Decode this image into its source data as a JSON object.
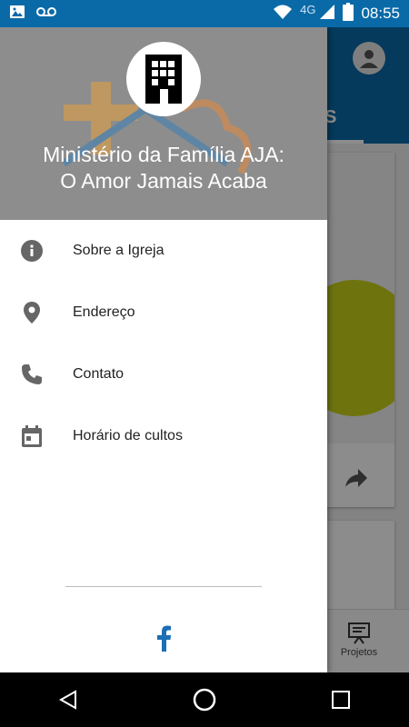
{
  "status_bar": {
    "time": "08:55",
    "network": "4G",
    "icons": [
      "image-icon",
      "voicemail-icon",
      "wifi-icon",
      "signal-icon",
      "battery-icon"
    ],
    "background": "#0a6aa8"
  },
  "drawer": {
    "header": {
      "title_line1": "Ministério da Família AJA:",
      "title_line2": "O Amor Jamais Acaba",
      "avatar_icon": "building-icon"
    },
    "items": [
      {
        "label": "Sobre a Igreja",
        "icon": "info-icon"
      },
      {
        "label": "Endereço",
        "icon": "location-pin-icon"
      },
      {
        "label": "Contato",
        "icon": "phone-icon"
      },
      {
        "label": "Horário de cultos",
        "icon": "calendar-icon"
      }
    ],
    "footer": {
      "icon": "facebook-icon",
      "color": "#1b6fb5"
    }
  },
  "background_app": {
    "tab_label": "S",
    "bottom_nav_label": "Projetos",
    "bottom_nav_icon": "presentation-icon",
    "share_icon": "share-icon"
  },
  "nav_bar": {
    "buttons": [
      "back-icon",
      "home-icon",
      "recents-icon"
    ]
  }
}
